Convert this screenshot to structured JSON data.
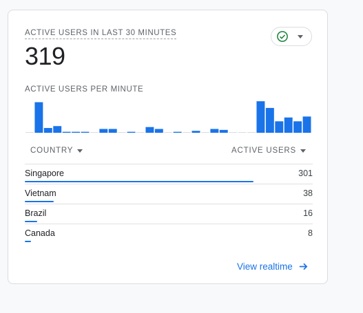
{
  "card": {
    "metric_title": "ACTIVE USERS IN LAST 30 MINUTES",
    "metric_value": "319",
    "chart_title": "ACTIVE USERS PER MINUTE"
  },
  "colors": {
    "accent": "#1a73e8",
    "check": "#188038"
  },
  "chart_data": {
    "type": "bar",
    "title": "ACTIVE USERS PER MINUTE",
    "x": [
      1,
      2,
      3,
      4,
      5,
      6,
      7,
      8,
      9,
      10,
      11,
      12,
      13,
      14,
      15,
      16,
      17,
      18,
      19,
      20,
      21,
      22,
      23,
      24,
      25,
      26,
      27,
      28,
      29,
      30
    ],
    "values": [
      0,
      32,
      5,
      7,
      1,
      1,
      1,
      0,
      4,
      4,
      0,
      1,
      0,
      6,
      4,
      0,
      1,
      0,
      2,
      0,
      4,
      3,
      0,
      0,
      0,
      33,
      26,
      12,
      16,
      12,
      17
    ],
    "ylim": [
      0,
      36
    ],
    "grid": false,
    "legend": "none"
  },
  "table": {
    "country_header": "COUNTRY",
    "users_header": "ACTIVE USERS",
    "rows": [
      {
        "country": "Singapore",
        "users": "301",
        "share": 301
      },
      {
        "country": "Vietnam",
        "users": "38",
        "share": 38
      },
      {
        "country": "Brazil",
        "users": "16",
        "share": 16
      },
      {
        "country": "Canada",
        "users": "8",
        "share": 8
      }
    ],
    "max_users": 379
  },
  "footer": {
    "link_label": "View realtime"
  },
  "icons": {
    "status": "check-circle-icon",
    "status_menu": "caret-down-icon",
    "link": "arrow-right-icon"
  }
}
